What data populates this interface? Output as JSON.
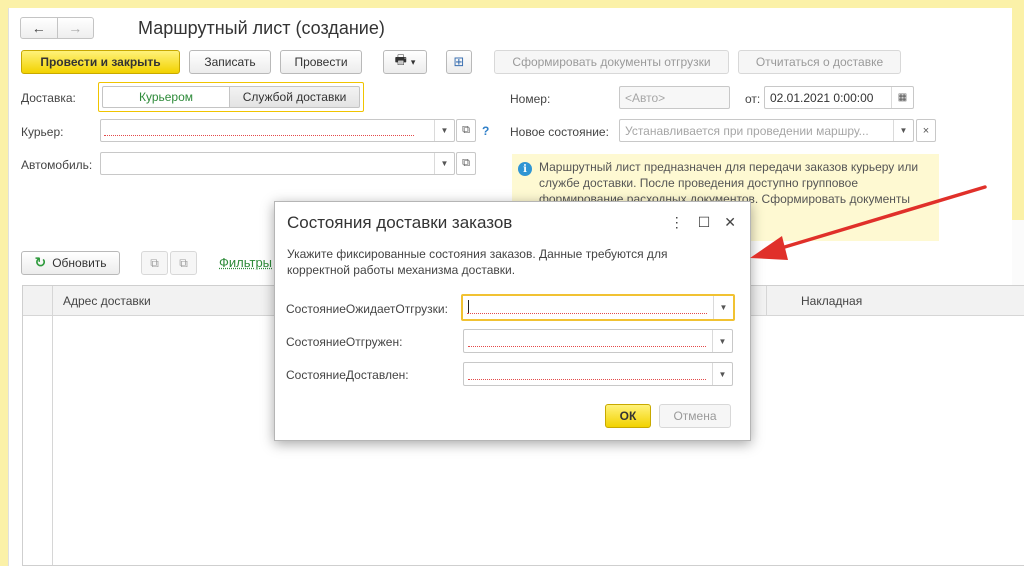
{
  "window": {
    "title": "Маршрутный лист (создание)"
  },
  "nav": {
    "back": "←",
    "forward": "→"
  },
  "toolbar": {
    "post_close": "Провести и закрыть",
    "save": "Записать",
    "post": "Провести",
    "print_icon": "🖶",
    "print_caret": "▾",
    "structure_icon": "⊞",
    "make_shipping_docs": "Сформировать документы отгрузки",
    "report_delivery": "Отчитаться о доставке"
  },
  "form": {
    "delivery_label": "Доставка:",
    "delivery_options": [
      "Курьером",
      "Службой доставки"
    ],
    "courier_label": "Курьер:",
    "vehicle_label": "Автомобиль:",
    "help": "?",
    "number_label": "Номер:",
    "number_placeholder": "<Авто>",
    "date_from_label": "от:",
    "date_value": "02.01.2021  0:00:00",
    "new_state_label": "Новое состояние:",
    "new_state_placeholder": "Устанавливается при проведении маршру...",
    "clear": "×"
  },
  "info": {
    "icon": "i",
    "text": "Маршрутный лист предназначен для передачи заказов курьеру или службе доставки. После проведения доступно групповое формирование расходных документов. Сформировать документы"
  },
  "grid_toolbar": {
    "refresh": "Обновить",
    "filters": "Фильтры"
  },
  "grid": {
    "columns": [
      "Адрес доставки",
      "Накладная"
    ]
  },
  "dialog": {
    "title": "Состояния доставки заказов",
    "more": "⋮",
    "maximize": "☐",
    "close": "✕",
    "description": "Укажите фиксированные состояния заказов. Данные требуются для корректной работы механизма доставки.",
    "fields": [
      {
        "label": "СостояниеОжидаетОтгрузки:"
      },
      {
        "label": "СостояниеОтгружен:"
      },
      {
        "label": "СостояниеДоставлен:"
      }
    ],
    "ok": "ОК",
    "cancel": "Отмена"
  },
  "colors": {
    "accent_yellow": "#f2d200",
    "required_red": "#e34a4a",
    "arrow_red": "#e0302a",
    "link_green": "#2e8b3a"
  }
}
